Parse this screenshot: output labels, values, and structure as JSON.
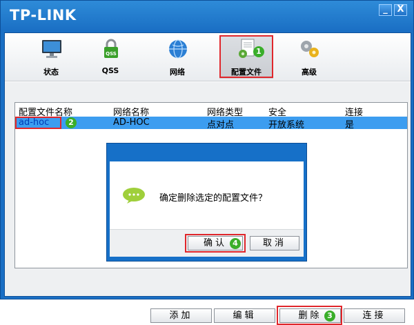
{
  "window": {
    "brand": "TP-LINK",
    "minimize_glyph": "_",
    "close_glyph": "X"
  },
  "toolbar": {
    "items": [
      {
        "label": "状态",
        "icon": "monitor-icon"
      },
      {
        "label": "QSS",
        "icon": "qss-lock-icon"
      },
      {
        "label": "网络",
        "icon": "globe-icon"
      },
      {
        "label": "配置文件",
        "icon": "profile-document-gear-icon"
      },
      {
        "label": "高级",
        "icon": "gears-icon"
      }
    ],
    "active_index": 3
  },
  "list": {
    "headers": [
      "配置文件名称",
      "网络名称",
      "网络类型",
      "安全",
      "连接"
    ],
    "rows": [
      {
        "profile": "ad-hoc",
        "network": "AD-HOC",
        "type": "点对点",
        "security": "开放系统",
        "connected": "是"
      }
    ]
  },
  "dialog": {
    "message": "确定删除选定的配置文件？",
    "ok_label": "确认",
    "cancel_label": "取消"
  },
  "actions": {
    "add_label": "添加",
    "edit_label": "编辑",
    "delete_label": "删除",
    "connect_label": "连接"
  },
  "step_badges": {
    "toolbar_profile": "1",
    "list_row": "2",
    "delete_button": "3",
    "ok_button": "4"
  },
  "colors": {
    "window_blue": "#1a6fc4",
    "selection_blue": "#3c9df0",
    "highlight_red": "#e0262b",
    "badge_green": "#3aae2a"
  }
}
